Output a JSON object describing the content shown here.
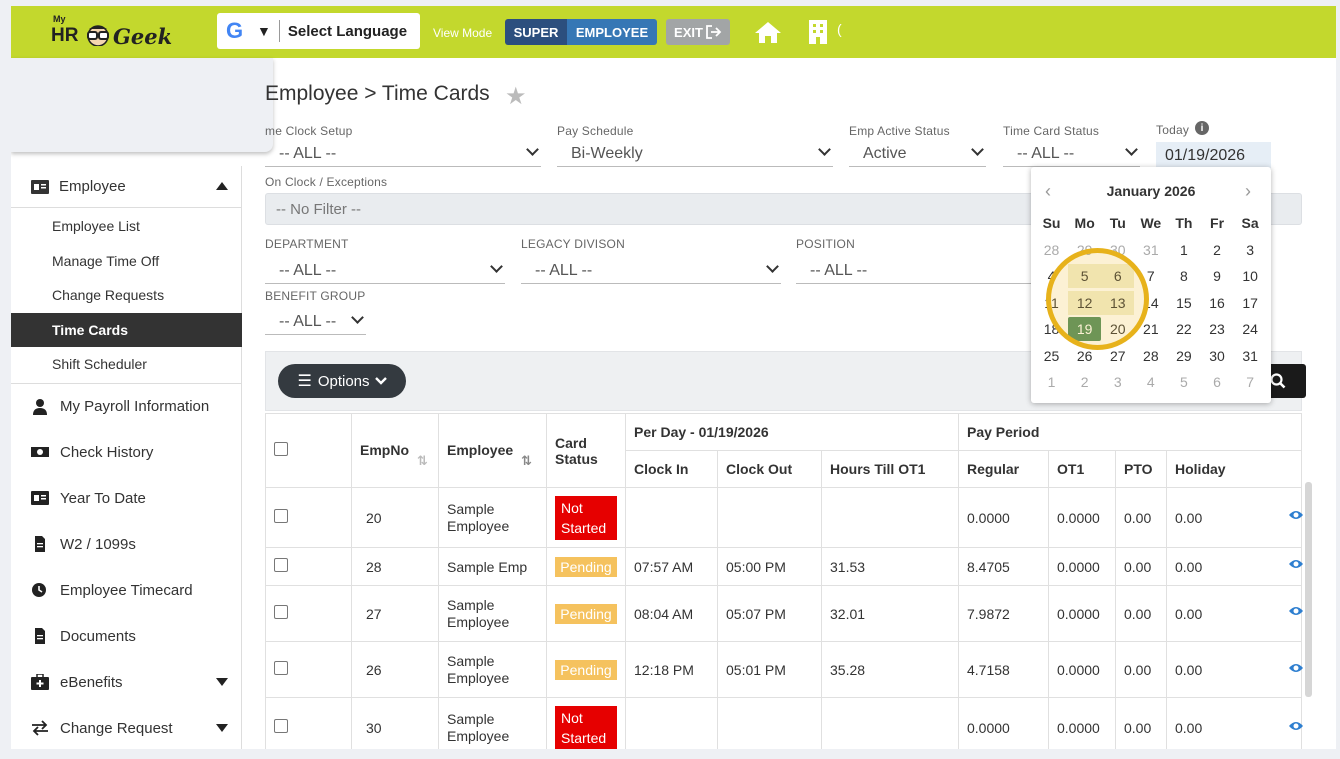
{
  "header": {
    "logo": {
      "my": "My",
      "hr": "HR",
      "geek": "Geek"
    },
    "language_g": "G",
    "language_label": "Select Language",
    "view_mode_label": "View Mode",
    "view_super": "SUPER",
    "view_employee": "EMPLOYEE",
    "exit_label": "EXIT",
    "trailing": "("
  },
  "sidebar": {
    "section": "Employee",
    "sub_items": [
      "Employee List",
      "Manage Time Off",
      "Change Requests",
      "Time Cards",
      "Shift Scheduler"
    ],
    "active_item": "Time Cards",
    "nav_items": [
      {
        "label": "My Payroll Information",
        "icon": "user-icon"
      },
      {
        "label": "Check History",
        "icon": "money-icon"
      },
      {
        "label": "Year To Date",
        "icon": "id-card-icon"
      },
      {
        "label": "W2 / 1099s",
        "icon": "document-icon"
      },
      {
        "label": "Employee Timecard",
        "icon": "clock-icon"
      },
      {
        "label": "Documents",
        "icon": "document-icon"
      },
      {
        "label": "eBenefits",
        "icon": "medkit-icon",
        "has_dropdown": true
      },
      {
        "label": "Change Request",
        "icon": "exchange-icon",
        "has_dropdown": true
      }
    ]
  },
  "page": {
    "breadcrumb": "Employee > Time Cards",
    "filters": {
      "time_clock_setup": {
        "label": "me Clock Setup",
        "value": "-- ALL --"
      },
      "pay_schedule": {
        "label": "Pay Schedule",
        "value": "Bi-Weekly"
      },
      "emp_active_status": {
        "label": "Emp Active Status",
        "value": "Active"
      },
      "time_card_status": {
        "label": "Time Card Status",
        "value": "-- ALL --"
      },
      "today": {
        "label": "Today",
        "value": "01/19/2026"
      },
      "on_clock": {
        "label": "On Clock / Exceptions",
        "value": "-- No Filter --"
      },
      "department": {
        "label": "DEPARTMENT",
        "value": "-- ALL --"
      },
      "legacy_division": {
        "label": "LEGACY DIVISON",
        "value": "-- ALL --"
      },
      "position": {
        "label": "POSITION",
        "value": "-- ALL --"
      },
      "benefit_group": {
        "label": "BENEFIT GROUP",
        "value": "-- ALL --"
      }
    },
    "options_label": "Options"
  },
  "table": {
    "headers": {
      "empno": "EmpNo",
      "employee": "Employee",
      "card_status": "Card Status",
      "per_day": "Per Day - 01/19/2026",
      "pay_period": "Pay Period",
      "clock_in": "Clock In",
      "clock_out": "Clock Out",
      "hours_till_ot1": "Hours Till OT1",
      "regular": "Regular",
      "ot1": "OT1",
      "pto": "PTO",
      "holiday": "Holiday"
    },
    "rows": [
      {
        "empno": "20",
        "employee": "Sample Employee",
        "status": "Not Started",
        "clock_in": "",
        "clock_out": "",
        "hours_till_ot1": "",
        "regular": "0.0000",
        "ot1": "0.0000",
        "pto": "0.00",
        "holiday": "0.00"
      },
      {
        "empno": "28",
        "employee": "Sample Emp",
        "status": "Pending",
        "clock_in": "07:57 AM",
        "clock_out": "05:00 PM",
        "hours_till_ot1": "31.53",
        "regular": "8.4705",
        "ot1": "0.0000",
        "pto": "0.00",
        "holiday": "0.00"
      },
      {
        "empno": "27",
        "employee": "Sample Employee",
        "status": "Pending",
        "clock_in": "08:04 AM",
        "clock_out": "05:07 PM",
        "hours_till_ot1": "32.01",
        "regular": "7.9872",
        "ot1": "0.0000",
        "pto": "0.00",
        "holiday": "0.00"
      },
      {
        "empno": "26",
        "employee": "Sample Employee",
        "status": "Pending",
        "clock_in": "12:18 PM",
        "clock_out": "05:01 PM",
        "hours_till_ot1": "35.28",
        "regular": "4.7158",
        "ot1": "0.0000",
        "pto": "0.00",
        "holiday": "0.00"
      },
      {
        "empno": "30",
        "employee": "Sample Employee",
        "status": "Not Started",
        "clock_in": "",
        "clock_out": "",
        "hours_till_ot1": "",
        "regular": "0.0000",
        "ot1": "0.0000",
        "pto": "0.00",
        "holiday": "0.00"
      }
    ]
  },
  "calendar": {
    "month_label": "January 2026",
    "prev": "‹",
    "next": "›",
    "weekdays": [
      "Su",
      "Mo",
      "Tu",
      "We",
      "Th",
      "Fr",
      "Sa"
    ],
    "weeks": [
      [
        "28",
        "29",
        "30",
        "31",
        "1",
        "2",
        "3"
      ],
      [
        "4",
        "5",
        "6",
        "7",
        "8",
        "9",
        "10"
      ],
      [
        "11",
        "12",
        "13",
        "14",
        "15",
        "16",
        "17"
      ],
      [
        "18",
        "19",
        "20",
        "21",
        "22",
        "23",
        "24"
      ],
      [
        "25",
        "26",
        "27",
        "28",
        "29",
        "30",
        "31"
      ],
      [
        "1",
        "2",
        "3",
        "4",
        "5",
        "6",
        "7"
      ]
    ],
    "selected_day": "19",
    "highlighted_days": [
      "5",
      "6",
      "12",
      "13"
    ]
  },
  "colors": {
    "topbar": "#c3d82d",
    "super_button": "#2c4f7e",
    "employee_button": "#3677b5",
    "status_not_started": "#e60000",
    "status_pending": "#f5c25e",
    "active_nav": "#333333",
    "highlight_ring": "#e7b21b",
    "selected_day": "#4a8a5e"
  }
}
